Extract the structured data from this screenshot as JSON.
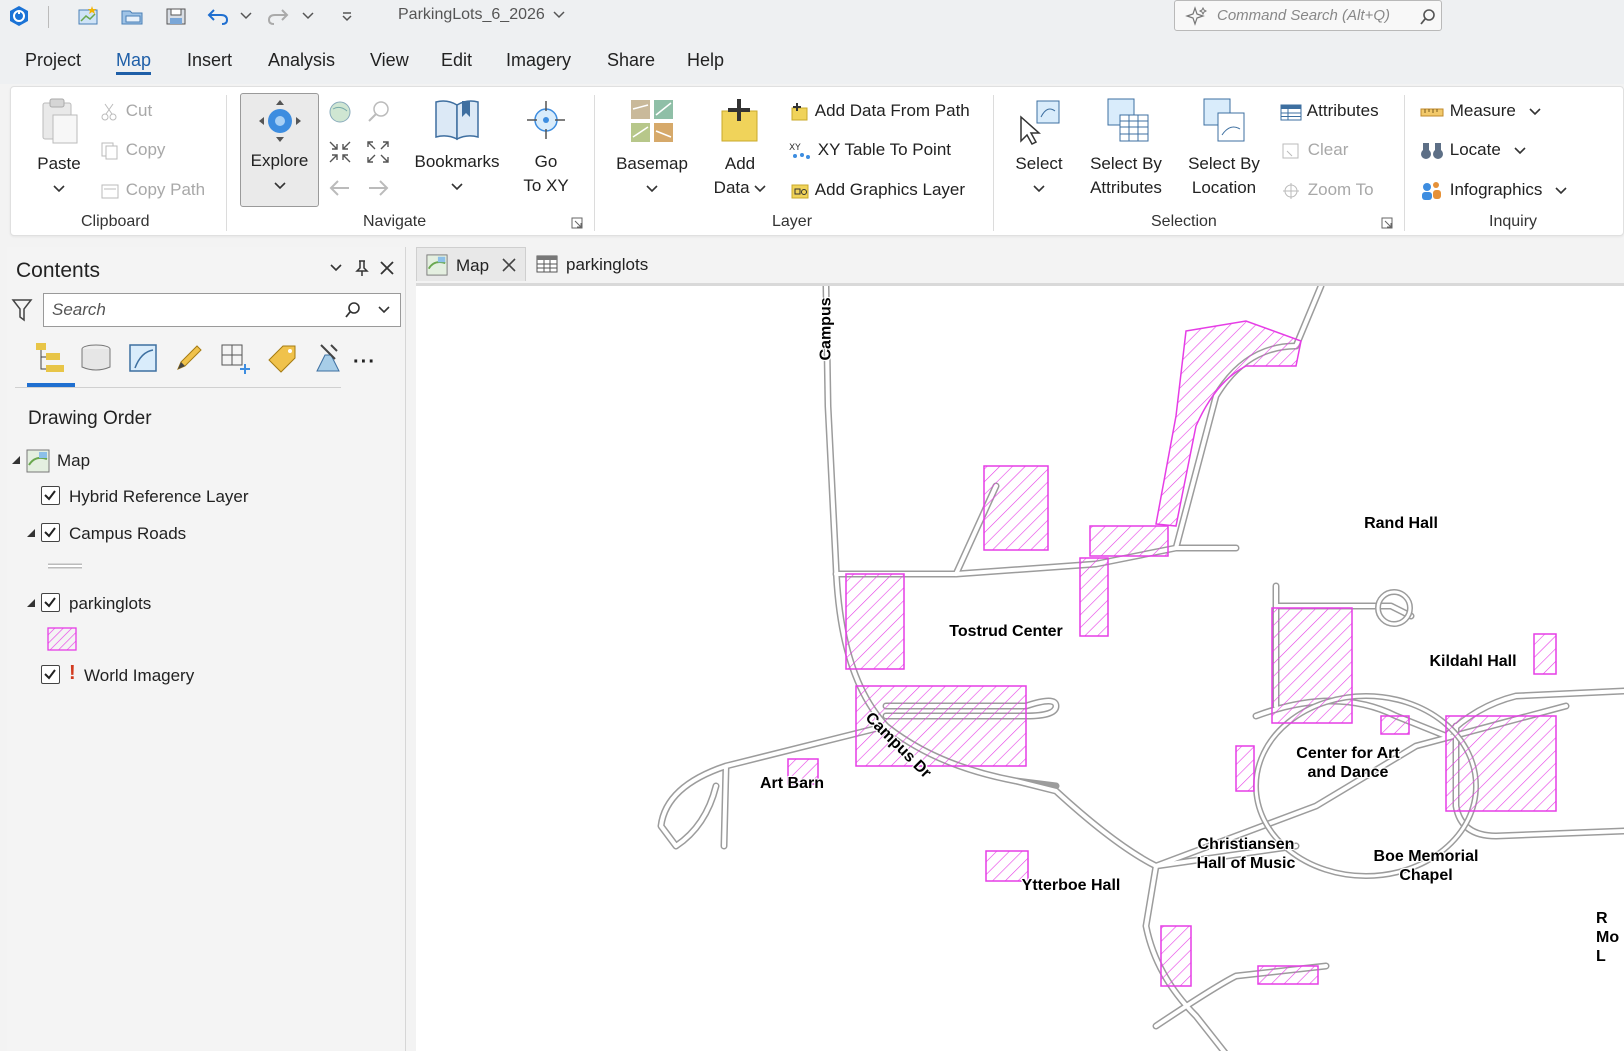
{
  "titlebar": {
    "document_title": "ParkingLots_6_2026",
    "command_search_placeholder": "Command Search (Alt+Q)"
  },
  "menu": {
    "items": [
      "Project",
      "Map",
      "Insert",
      "Analysis",
      "View",
      "Edit",
      "Imagery",
      "Share",
      "Help"
    ],
    "active": "Map"
  },
  "ribbon": {
    "clipboard": {
      "group": "Clipboard",
      "paste": "Paste",
      "cut": "Cut",
      "copy": "Copy",
      "copy_path": "Copy Path"
    },
    "navigate": {
      "group": "Navigate",
      "explore": "Explore",
      "bookmarks": "Bookmarks",
      "go_to_xy_1": "Go",
      "go_to_xy_2": "To XY"
    },
    "layer": {
      "group": "Layer",
      "basemap": "Basemap",
      "add_data_1": "Add",
      "add_data_2": "Data",
      "add_data_from_path": "Add Data From Path",
      "xy_table_to_point": "XY Table To Point",
      "add_graphics_layer": "Add Graphics Layer"
    },
    "selection": {
      "group": "Selection",
      "select": "Select",
      "select_by_attributes_1": "Select By",
      "select_by_attributes_2": "Attributes",
      "select_by_location_1": "Select By",
      "select_by_location_2": "Location",
      "attributes": "Attributes",
      "clear": "Clear",
      "zoom_to": "Zoom To"
    },
    "inquiry": {
      "group": "Inquiry",
      "measure": "Measure",
      "locate": "Locate",
      "infographics": "Infographics"
    }
  },
  "contents": {
    "title": "Contents",
    "search_placeholder": "Search",
    "drawing_order": "Drawing Order",
    "map_name": "Map",
    "layers": {
      "hybrid": "Hybrid Reference Layer",
      "roads": "Campus Roads",
      "parkinglots": "parkinglots",
      "imagery": "World Imagery"
    }
  },
  "tabs": {
    "map": "Map",
    "table": "parkinglots"
  },
  "map_labels": {
    "campus_vertical": "Campus",
    "campus_dr": "Campus Dr",
    "rand": "Rand Hall",
    "tostrud": "Tostrud Center",
    "kildahl": "Kildahl Hall",
    "caad_1": "Center for Art",
    "caad_2": "and Dance",
    "art_barn": "Art Barn",
    "christiansen_1": "Christiansen",
    "christiansen_2": "Hall of Music",
    "boe_1": "Boe Memorial",
    "boe_2": "Chapel",
    "ytterboe": "Ytterboe Hall",
    "edge_1": "R",
    "edge_2": "Mo",
    "edge_3": "L"
  },
  "colors": {
    "accent": "#1f5fa8",
    "parking": "#e63de6",
    "road": "#9c9c9c"
  }
}
